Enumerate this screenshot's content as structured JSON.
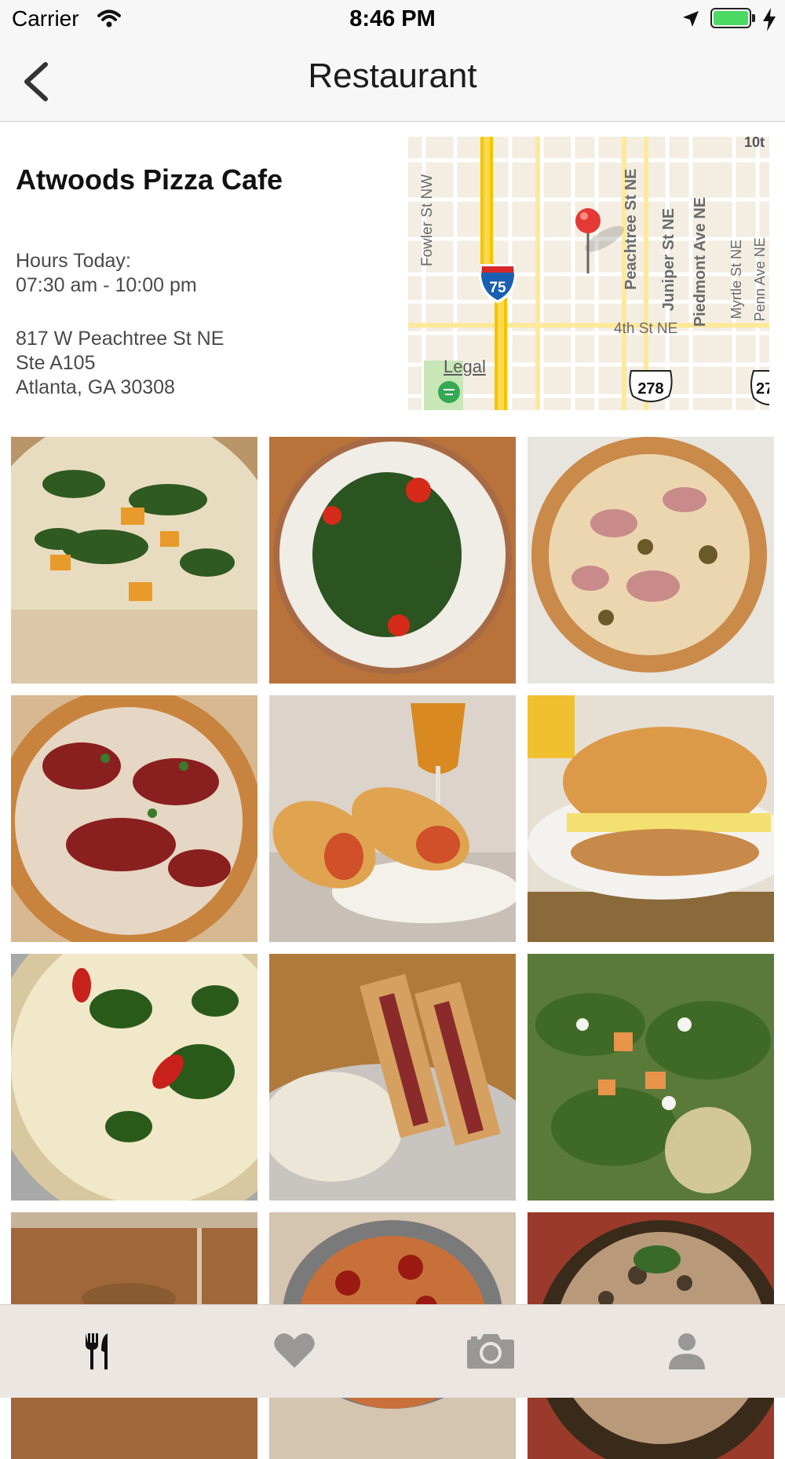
{
  "status_bar": {
    "carrier": "Carrier",
    "time": "8:46 PM",
    "battery_color": "#4cd964"
  },
  "nav": {
    "title": "Restaurant",
    "back_icon": "chevron-left-icon"
  },
  "restaurant": {
    "name": "Atwoods Pizza Cafe",
    "hours_label": "Hours Today:",
    "hours_value": "07:30 am - 10:00 pm",
    "address_lines": [
      "817 W Peachtree St NE",
      "Ste A105",
      "Atlanta, GA 30308"
    ]
  },
  "map": {
    "legal": "Legal",
    "street_labels": [
      "Fowler St NW",
      "Peachtree St NE",
      "Juniper St NE",
      "Piedmont Ave NE",
      "Myrtle St NE",
      "Penn Ave NE",
      "4th St NE",
      "10t"
    ],
    "shields": [
      "75",
      "278",
      "27"
    ],
    "pin_color": "#e53935"
  },
  "photos": [
    {
      "name": "photo-pizza-spinach-squash",
      "bg": "#c8a070",
      "accent": "#3d6b2a"
    },
    {
      "name": "photo-kale-salad-plate",
      "bg": "#b9743a",
      "accent": "#2e5a22"
    },
    {
      "name": "photo-pizza-ham-artichoke",
      "bg": "#d9c3a0",
      "accent": "#a85a3c"
    },
    {
      "name": "photo-pizza-bbq-prosciutto",
      "bg": "#c46a4a",
      "accent": "#7a1f1f"
    },
    {
      "name": "photo-stuffed-bread-beer",
      "bg": "#d8cfc4",
      "accent": "#d69a3a"
    },
    {
      "name": "photo-croissant-sandwich",
      "bg": "#c9ac85",
      "accent": "#e0a040"
    },
    {
      "name": "photo-pizza-broccoli-peppers",
      "bg": "#e0d2a8",
      "accent": "#3a6a2a"
    },
    {
      "name": "photo-reuben-sandwich-potato-salad",
      "bg": "#b98a5a",
      "accent": "#8a3a2a"
    },
    {
      "name": "photo-arugula-salad",
      "bg": "#6a8a4a",
      "accent": "#e0944a"
    },
    {
      "name": "photo-wood-table-drink",
      "bg": "#a0683a",
      "accent": "#c8b49a"
    },
    {
      "name": "photo-pizza-onion-sausage",
      "bg": "#c2a88a",
      "accent": "#8a2a1a"
    },
    {
      "name": "photo-pizza-box-mushroom",
      "bg": "#9a5a3a",
      "accent": "#2a2a1a"
    }
  ],
  "tab_bar": {
    "tabs": [
      {
        "name": "tab-restaurants",
        "icon": "fork-knife-icon",
        "active": true
      },
      {
        "name": "tab-favorites",
        "icon": "heart-icon",
        "active": false
      },
      {
        "name": "tab-camera",
        "icon": "camera-icon",
        "active": false
      },
      {
        "name": "tab-profile",
        "icon": "person-icon",
        "active": false
      }
    ],
    "active_color": "#111111",
    "inactive_color": "#9a9895"
  }
}
